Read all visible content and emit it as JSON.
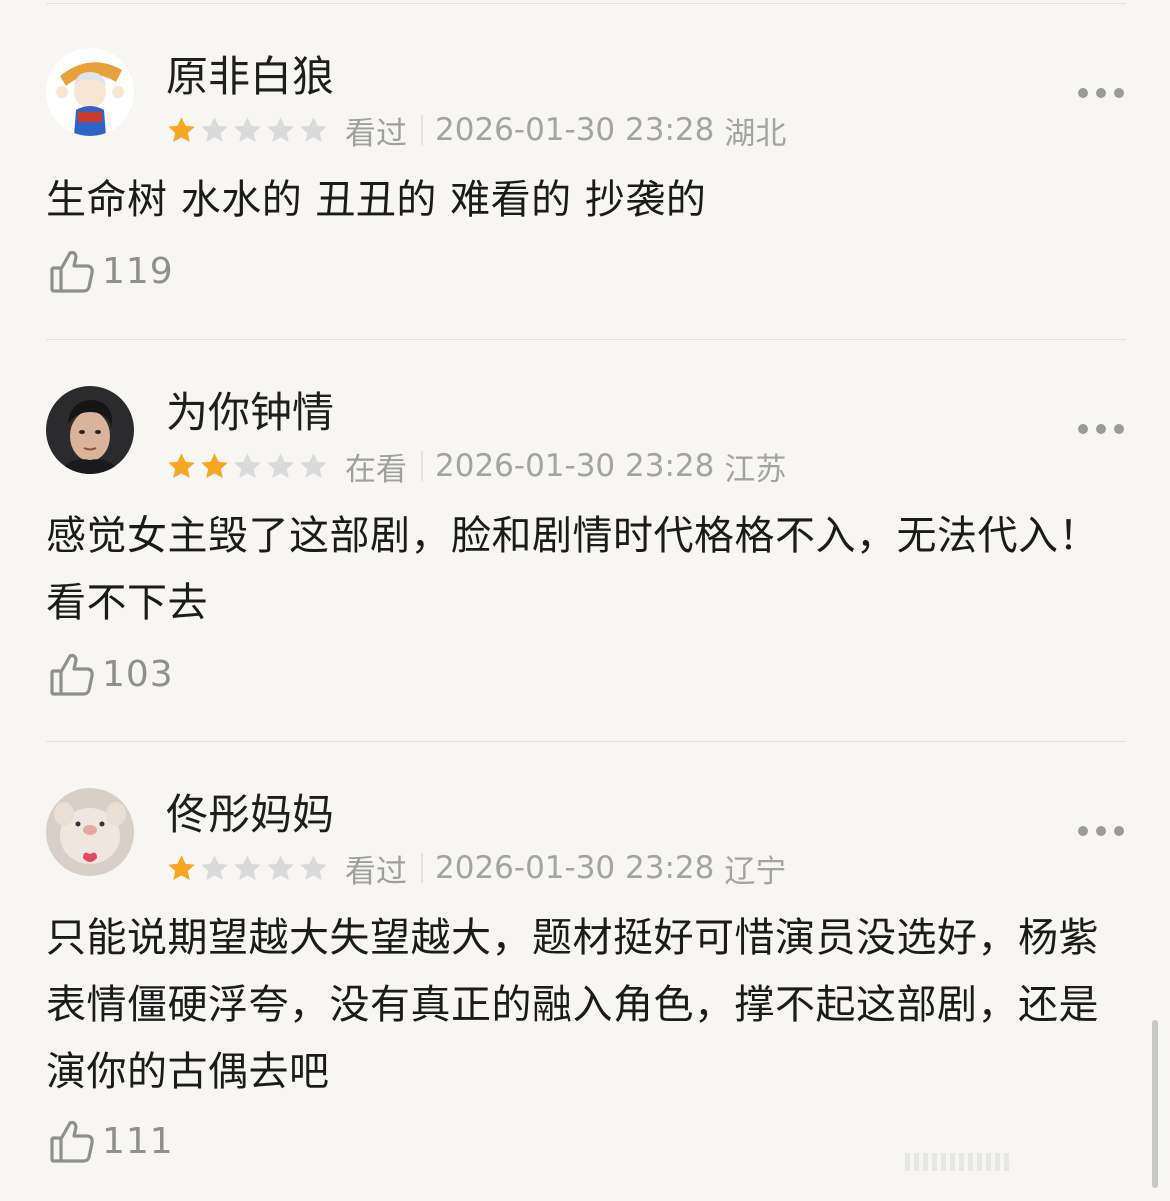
{
  "comments": [
    {
      "username": "原非白狼",
      "rating": 1,
      "status": "看过",
      "time": "2026-01-30 23:28",
      "location": "湖北",
      "text": "生命树 水水的 丑丑的 难看的 抄袭的",
      "likes": "119"
    },
    {
      "username": "为你钟情",
      "rating": 2,
      "status": "在看",
      "time": "2026-01-30 23:28",
      "location": "江苏",
      "text": "感觉女主毁了这部剧，脸和剧情时代格格不入，无法代入！看不下去",
      "likes": "103"
    },
    {
      "username": "佟彤妈妈",
      "rating": 1,
      "status": "看过",
      "time": "2026-01-30 23:28",
      "location": "辽宁",
      "text": "只能说期望越大失望越大，题材挺好可惜演员没选好，杨紫表情僵硬浮夸，没有真正的融入角色，撑不起这部剧，还是演你的古偶去吧",
      "likes": "111"
    }
  ],
  "rating_max": 5,
  "icons": {
    "star": "star-icon",
    "more": "more-dots-icon",
    "like": "thumbs-up-icon"
  },
  "colors": {
    "star_filled": "#f5a623",
    "star_empty": "#dadada",
    "meta_text": "#a3a3a3",
    "background": "#f7f6f3"
  }
}
